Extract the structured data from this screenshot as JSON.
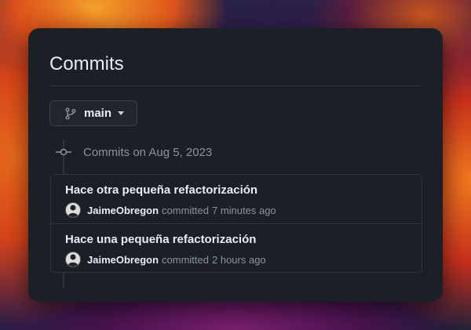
{
  "page": {
    "title": "Commits"
  },
  "branch": {
    "name": "main"
  },
  "group": {
    "heading": "Commits on Aug 5, 2023"
  },
  "commits": [
    {
      "message": "Hace otra pequeña refactorización",
      "author": "JaimeObregon",
      "verb": "committed",
      "time": "7 minutes ago"
    },
    {
      "message": "Hace una pequeña refactorización",
      "author": "JaimeObregon",
      "verb": "committed",
      "time": "2 hours ago"
    }
  ],
  "icons": {
    "branch": "git-branch-icon",
    "caret": "caret-down-icon",
    "commit": "git-commit-icon"
  },
  "colors": {
    "panel": "#1b1f26",
    "text": "#e6edf3",
    "muted": "#8b949e",
    "border": "#30363d"
  }
}
